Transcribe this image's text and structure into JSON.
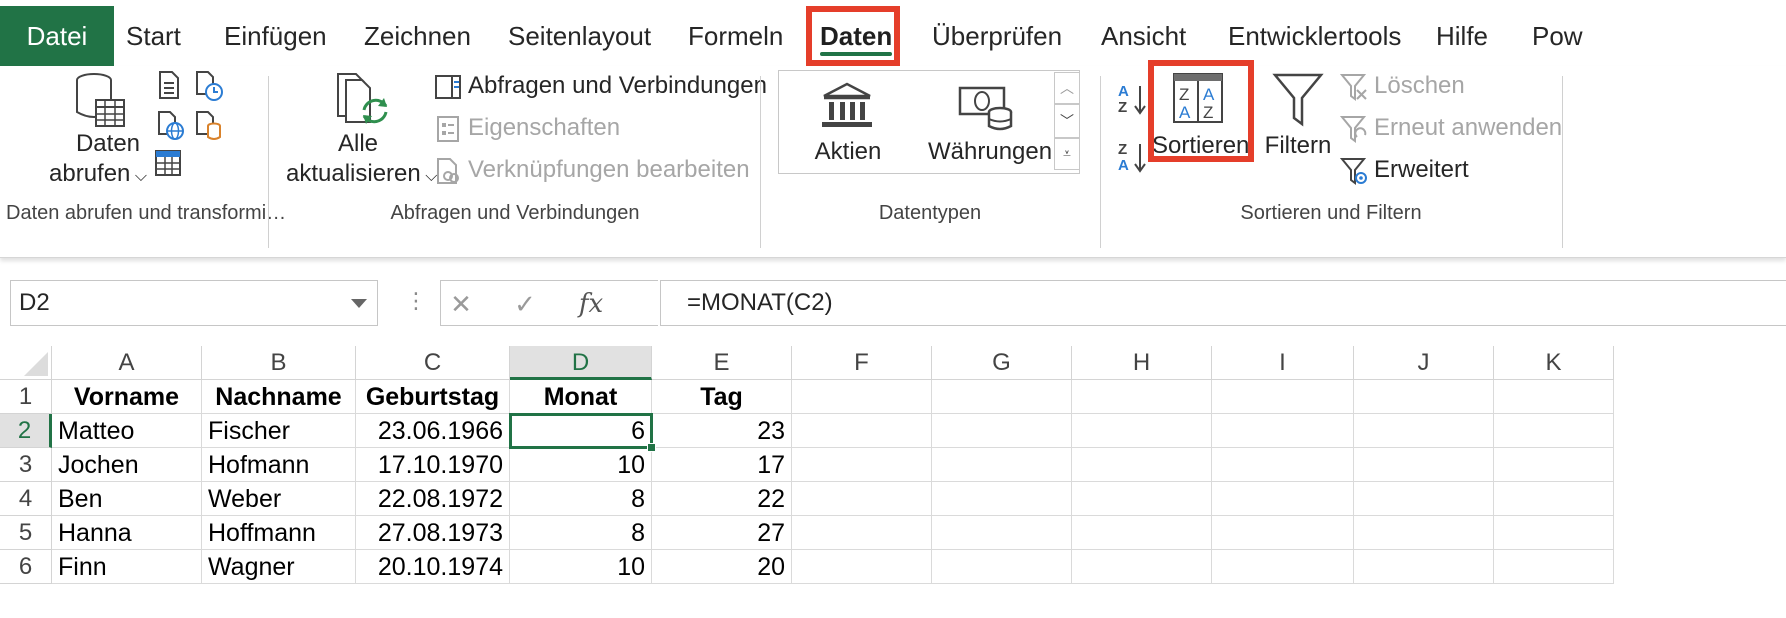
{
  "ribbon_tabs": {
    "file": "Datei",
    "start": "Start",
    "insert": "Einfügen",
    "draw": "Zeichnen",
    "page_layout": "Seitenlayout",
    "formulas": "Formeln",
    "data": "Daten",
    "review": "Überprüfen",
    "view": "Ansicht",
    "developer": "Entwicklertools",
    "help": "Hilfe",
    "power": "Pow"
  },
  "groups": {
    "get_data": {
      "label": "Daten abrufen und transformi…",
      "button_line1": "Daten",
      "button_line2": "abrufen"
    },
    "queries": {
      "label": "Abfragen und Verbindungen",
      "refresh_line1": "Alle",
      "refresh_line2": "aktualisieren",
      "queries_connections": "Abfragen und Verbindungen",
      "properties": "Eigenschaften",
      "edit_links": "Verknüpfungen bearbeiten"
    },
    "data_types": {
      "label": "Datentypen",
      "stocks": "Aktien",
      "currencies": "Währungen"
    },
    "sort_filter": {
      "label": "Sortieren und Filtern",
      "sort": "Sortieren",
      "filter": "Filtern",
      "clear": "Löschen",
      "reapply": "Erneut anwenden",
      "advanced": "Erweitert"
    }
  },
  "formula_bar": {
    "name_box": "D2",
    "formula": "=MONAT(C2)",
    "fx": "fx"
  },
  "grid": {
    "columns": [
      "A",
      "B",
      "C",
      "D",
      "E",
      "F",
      "G",
      "H",
      "I",
      "J",
      "K"
    ],
    "rows": [
      {
        "num": "1",
        "cells": [
          "Vorname",
          "Nachname",
          "Geburtstag",
          "Monat",
          "Tag"
        ]
      },
      {
        "num": "2",
        "cells": [
          "Matteo",
          "Fischer",
          "23.06.1966",
          "6",
          "23"
        ]
      },
      {
        "num": "3",
        "cells": [
          "Jochen",
          "Hofmann",
          "17.10.1970",
          "10",
          "17"
        ]
      },
      {
        "num": "4",
        "cells": [
          "Ben",
          "Weber",
          "22.08.1972",
          "8",
          "22"
        ]
      },
      {
        "num": "5",
        "cells": [
          "Hanna",
          "Hoffmann",
          "27.08.1973",
          "8",
          "27"
        ]
      },
      {
        "num": "6",
        "cells": [
          "Finn",
          "Wagner",
          "20.10.1974",
          "10",
          "20"
        ]
      }
    ]
  },
  "colors": {
    "excel_green": "#217346",
    "highlight_red": "#e53e2a"
  }
}
